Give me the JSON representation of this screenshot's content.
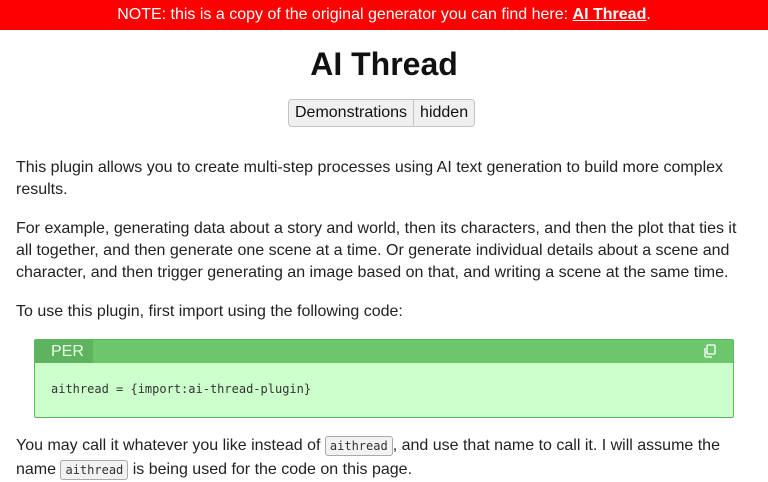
{
  "banner": {
    "text": "NOTE: this is a copy of the original generator you can find here: ",
    "link": "AI Thread",
    "end": "."
  },
  "page_title": "AI Thread",
  "toggle": {
    "label": "Demonstrations",
    "state": "hidden"
  },
  "paragraphs": {
    "intro": "This plugin allows you to create multi-step processes using AI text generation to build more complex results.",
    "example": "For example, generating data about a story and world, then its characters, and then the plot that ties it all together, and then generate one scene at a time. Or generate individual details about a scene and character, and then trigger generating an image based on that, and writing a scene at the same time.",
    "usage": "To use this plugin, first import using the following code:",
    "call_a": "You may call it whatever you like instead of ",
    "call_code": "aithread",
    "call_b": ", and use that name to call it. I will assume the name ",
    "call_code2": "aithread",
    "call_c": " is being used for the code on this page."
  },
  "code_block": {
    "lang": "PER",
    "code": "aithread = {import:ai-thread-plugin}",
    "copy_icon": "copy-icon"
  }
}
